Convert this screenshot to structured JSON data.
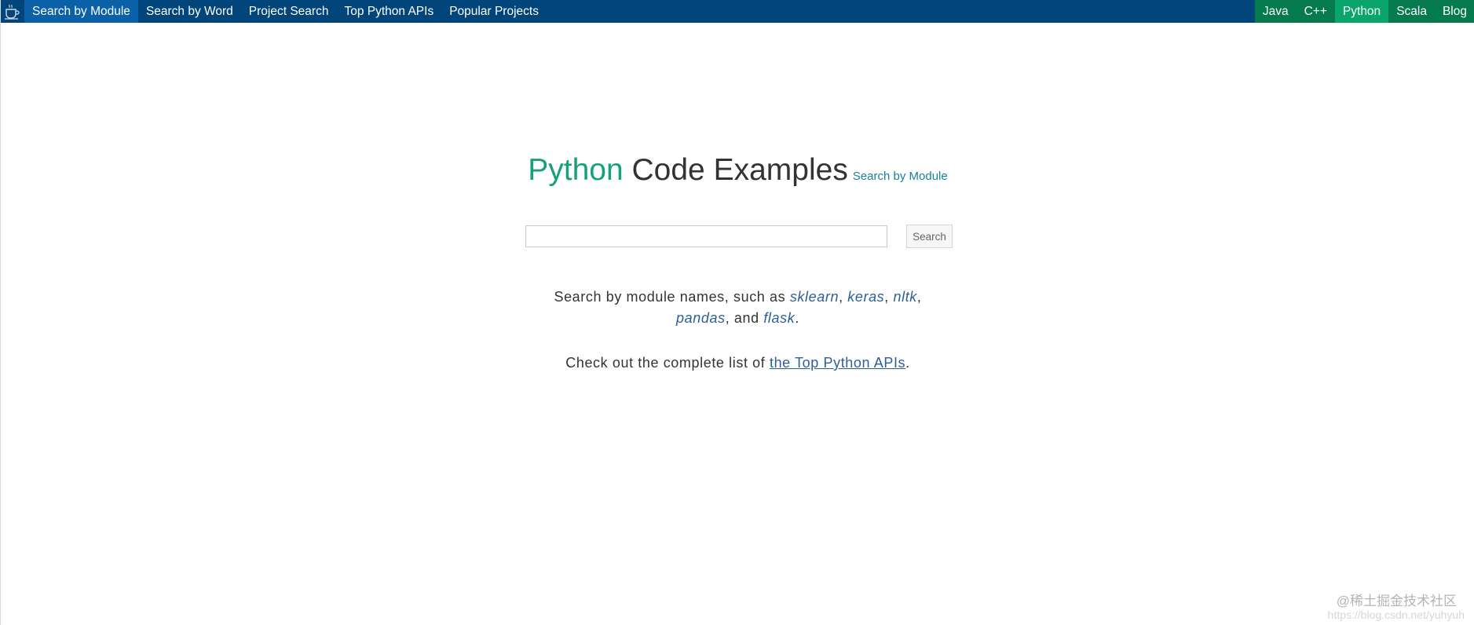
{
  "topnav": {
    "left_items": [
      {
        "label": "Search by Module"
      },
      {
        "label": "Search by Word"
      },
      {
        "label": "Project Search"
      },
      {
        "label": "Top Python APIs"
      },
      {
        "label": "Popular Projects"
      }
    ],
    "right_items": [
      {
        "label": "Java"
      },
      {
        "label": "C++"
      },
      {
        "label": "Python"
      },
      {
        "label": "Scala"
      },
      {
        "label": "Blog"
      }
    ],
    "logo_icon": "coffee-cup-icon",
    "colors": {
      "bar": "#02457a",
      "active_left": "#0a61a8",
      "right_group": "#057a4f",
      "active_right": "#0aa56c"
    }
  },
  "hero": {
    "title_accent": "Python",
    "title_rest": "Code Examples",
    "subtitle_link": "Search by Module",
    "accent_color": "#18a07a"
  },
  "search": {
    "value": "",
    "placeholder": "",
    "button_label": "Search"
  },
  "info": {
    "line1_prefix": "Search by module names, such as",
    "modules": [
      "sklearn",
      "keras",
      "nltk",
      "pandas",
      "flask"
    ],
    "line2_prefix": "Check out the complete list of",
    "api_link": "the Top Python APIs",
    "line2_suffix": "."
  },
  "watermark": {
    "text": "@稀土掘金技术社区",
    "url": "https://blog.csdn.net/yuhyuh"
  }
}
